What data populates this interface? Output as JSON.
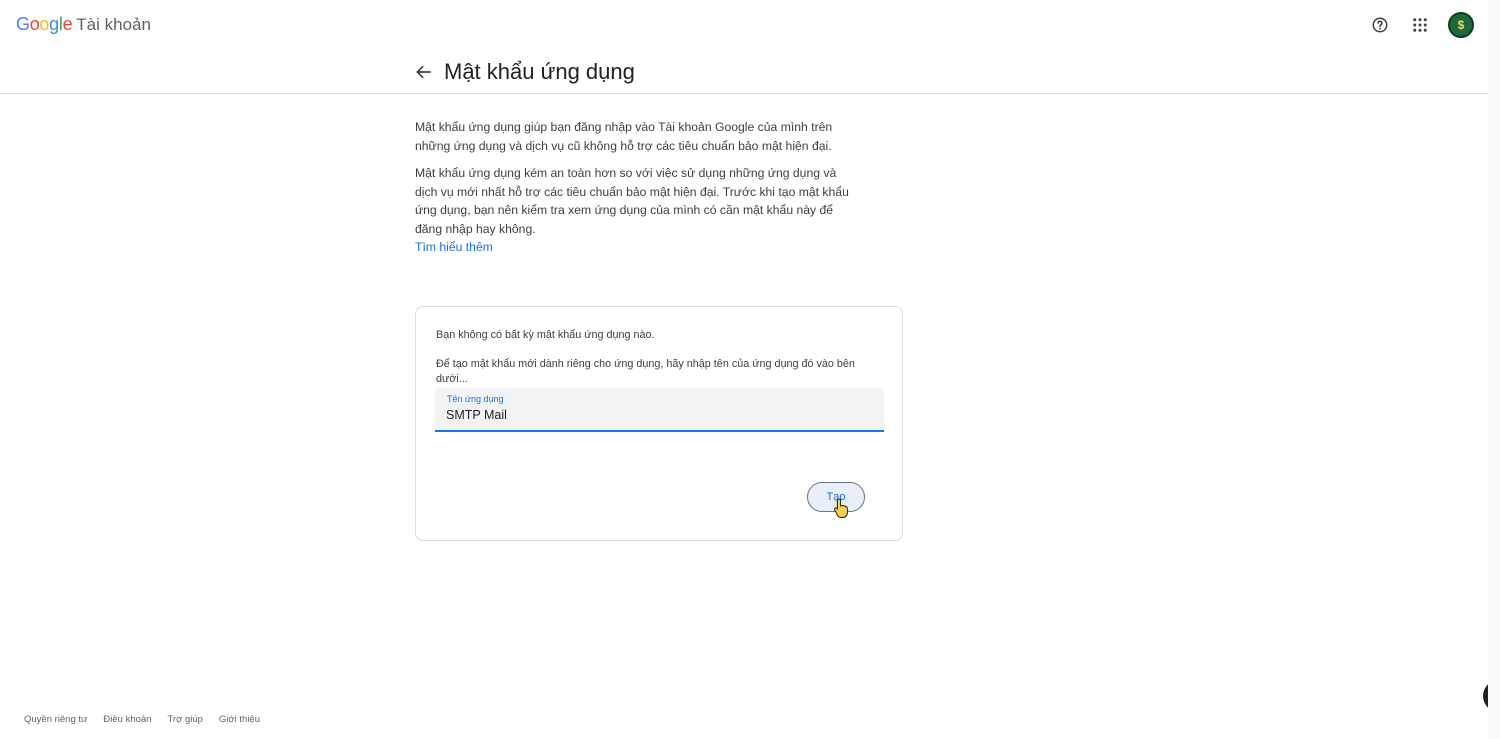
{
  "topbar": {
    "brand_letters": [
      "G",
      "o",
      "o",
      "g",
      "l",
      "e"
    ],
    "product_name": "Tài khoản",
    "icons": [
      "help-icon",
      "apps-grid-icon",
      "avatar"
    ],
    "avatar_initial": "$"
  },
  "header": {
    "back_icon": "arrow-left-icon",
    "title": "Mật khẩu ứng dụng"
  },
  "intro": {
    "paragraph1": "Mật khẩu ứng dụng giúp bạn đăng nhập vào Tài khoản Google của mình trên những ứng dụng và dịch vụ cũ không hỗ trợ các tiêu chuẩn bảo mật hiện đại.",
    "paragraph2": "Mật khẩu ứng dụng kém an toàn hơn so với việc sử dụng những ứng dụng và dịch vụ mới nhất hỗ trợ các tiêu chuẩn bảo mật hiện đại. Trước khi tạo mật khẩu ứng dụng, bạn nên kiểm tra xem ứng dụng của mình có cần mật khẩu này để đăng nhập hay không.",
    "learn_more": "Tìm hiểu thêm"
  },
  "card": {
    "empty_message": "Bạn không có bất kỳ mật khẩu ứng dụng nào.",
    "instruction": "Để tạo mật khẩu mới dành riêng cho ứng dụng, hãy nhập tên của ứng dụng đó vào bên dưới...",
    "field_label": "Tên ứng dụng",
    "field_value": "SMTP Mail",
    "create_label": "Tạo"
  },
  "footer": {
    "links": [
      "Quyền riêng tư",
      "Điều khoản",
      "Trợ giúp",
      "Giới thiệu"
    ]
  },
  "colors": {
    "accent": "#1a73e8",
    "text": "#202124",
    "muted": "#5f6368",
    "border": "#dadce0"
  }
}
